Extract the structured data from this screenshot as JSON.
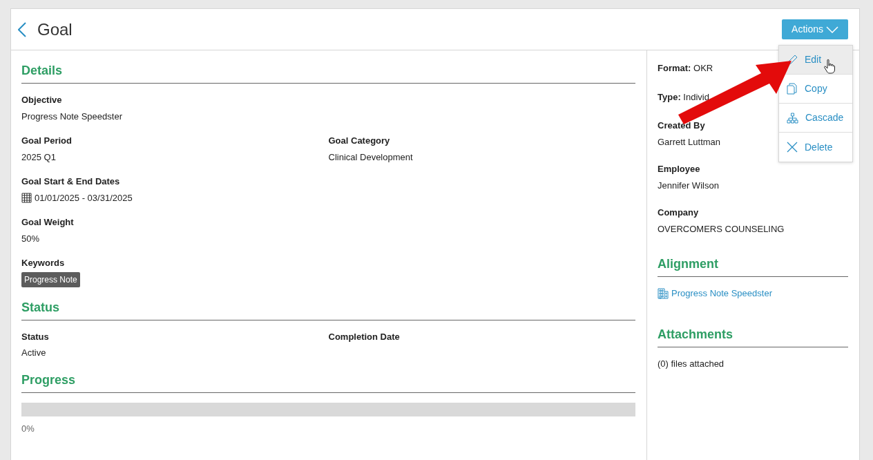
{
  "header": {
    "title": "Goal",
    "actions_button": "Actions"
  },
  "actions_menu": [
    {
      "label": "Edit",
      "kind": "edit",
      "highlighted": true
    },
    {
      "label": "Copy",
      "kind": "copy",
      "highlighted": false
    },
    {
      "label": "Cascade",
      "kind": "cascade",
      "highlighted": false
    },
    {
      "label": "Delete",
      "kind": "delete",
      "highlighted": false
    }
  ],
  "details": {
    "heading": "Details",
    "fields": [
      {
        "label": "Objective",
        "value": "Progress Note Speedster",
        "kind": "full"
      },
      {
        "label": "Goal Period",
        "value": "2025 Q1",
        "kind": "half"
      },
      {
        "label": "Goal Category",
        "value": "Clinical Development",
        "kind": "half"
      },
      {
        "label": "Goal Start & End Dates",
        "value": "01/01/2025 - 03/31/2025",
        "kind": "dates"
      },
      {
        "label": "Goal Weight",
        "value": "50%",
        "kind": "full"
      },
      {
        "label": "Keywords",
        "value": "Progress Note",
        "kind": "tag"
      }
    ]
  },
  "status": {
    "heading": "Status",
    "fields": [
      {
        "label": "Status",
        "value": "Active"
      },
      {
        "label": "Completion Date"
      }
    ]
  },
  "progress": {
    "heading": "Progress",
    "level": 0,
    "reading": "0%"
  },
  "side": {
    "inline": [
      {
        "label": "Format:",
        "value": "OKR"
      },
      {
        "label": "Type:",
        "value": "Individ"
      }
    ],
    "fields": [
      {
        "label": "Created By",
        "value": "Garrett Luttman"
      },
      {
        "label": "Employee",
        "value": "Jennifer Wilson"
      },
      {
        "label": "Company",
        "value": "OVERCOMERS COUNSELING"
      }
    ],
    "alignment": {
      "heading": "Alignment",
      "link": "Progress Note Speedster"
    },
    "attachments": {
      "heading": "Attachments",
      "text": "(0) files attached"
    }
  }
}
